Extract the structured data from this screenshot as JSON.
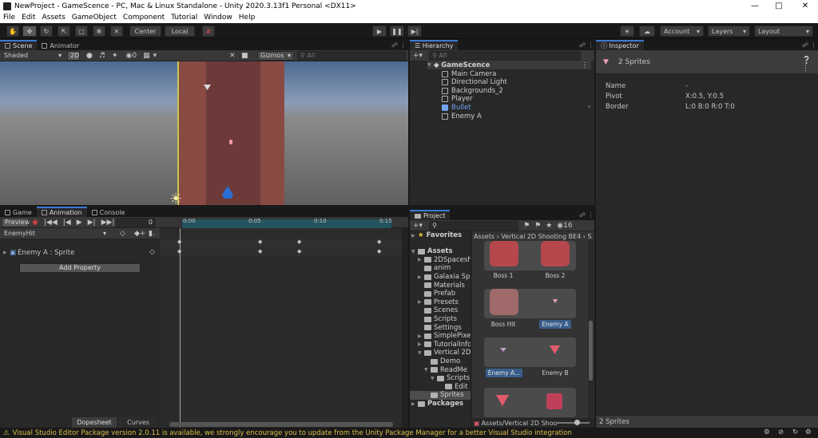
{
  "window": {
    "title": "NewProject - GameScence - PC, Mac & Linux Standalone - Unity 2020.3.13f1 Personal <DX11>"
  },
  "menu": [
    "File",
    "Edit",
    "Assets",
    "GameObject",
    "Component",
    "Tutorial",
    "Window",
    "Help"
  ],
  "toolbar": {
    "center": "Center",
    "local": "Local",
    "account": "Account",
    "layers": "Layers",
    "layout": "Layout"
  },
  "scene": {
    "tabs": [
      "Scene",
      "Animator"
    ],
    "shading": "Shaded",
    "mode2d": "2D",
    "gizmos": "Gizmos",
    "search_placeholder": "All",
    "hidden_count": "0"
  },
  "animation": {
    "tabs": [
      "Game",
      "Animation",
      "Console"
    ],
    "preview": "Preview",
    "frame": "0",
    "clip": "EnemyHit",
    "property": "Enemy A : Sprite",
    "add_property": "Add Property",
    "dopesheet": "Dopesheet",
    "curves": "Curves",
    "ticks": [
      "0:00",
      "0:05",
      "0:10",
      "0:15"
    ]
  },
  "hierarchy": {
    "tab": "Hierarchy",
    "search_placeholder": "All",
    "scene": "GameScence",
    "items": [
      "Main Camera",
      "Directional Light",
      "Backgrounds_2",
      "Player",
      "Bullet",
      "Enemy A"
    ],
    "selected": "Bullet"
  },
  "project": {
    "tab": "Project",
    "favorites": "Favorites",
    "breadcrumb": [
      "Assets",
      "Vertical 2D Shooting BE4",
      "S"
    ],
    "count": "16",
    "footer_path": "Assets/Vertical 2D Shoo",
    "tree": [
      {
        "label": "Assets",
        "depth": 0,
        "open": true
      },
      {
        "label": "2DSpacesh",
        "depth": 1
      },
      {
        "label": "anim",
        "depth": 1
      },
      {
        "label": "Galaxia Spr",
        "depth": 1
      },
      {
        "label": "Materials",
        "depth": 1
      },
      {
        "label": "Prefab",
        "depth": 1
      },
      {
        "label": "Presets",
        "depth": 1
      },
      {
        "label": "Scenes",
        "depth": 1
      },
      {
        "label": "Scripts",
        "depth": 1
      },
      {
        "label": "Settings",
        "depth": 1
      },
      {
        "label": "SimplePixel",
        "depth": 1
      },
      {
        "label": "TutorialInfo",
        "depth": 1
      },
      {
        "label": "Vertical 2D",
        "depth": 1,
        "open": true
      },
      {
        "label": "Demo",
        "depth": 2
      },
      {
        "label": "ReadMe",
        "depth": 2,
        "open": true
      },
      {
        "label": "Scripts",
        "depth": 3,
        "open": true
      },
      {
        "label": "Edit",
        "depth": 4
      },
      {
        "label": "Sprites",
        "depth": 2,
        "selected": true
      },
      {
        "label": "Packages",
        "depth": 0
      }
    ],
    "assets": [
      "Boss 1",
      "Boss 2",
      "Boss Hit",
      "Enemy A",
      "Enemy A...",
      "Enemy B"
    ],
    "selected_assets": [
      "Enemy A",
      "Enemy A..."
    ]
  },
  "inspector": {
    "tab": "Inspector",
    "title": "2 Sprites",
    "fields": [
      {
        "label": "Name",
        "value": "-"
      },
      {
        "label": "Pivot",
        "value": "X:0.5, Y:0.5"
      },
      {
        "label": "Border",
        "value": "L:0 B:0 R:0 T:0"
      }
    ],
    "footer": "2 Sprites"
  },
  "status": {
    "message": "Visual Studio Editor Package version 2.0.11 is available, we strongly encourage you to update from the Unity Package Manager for a better Visual Studio integration"
  },
  "colors": {
    "accent": "#3a7ad5",
    "selection": "#2c5d87",
    "road": "#8a4a44",
    "warning": "#d6c04a"
  }
}
